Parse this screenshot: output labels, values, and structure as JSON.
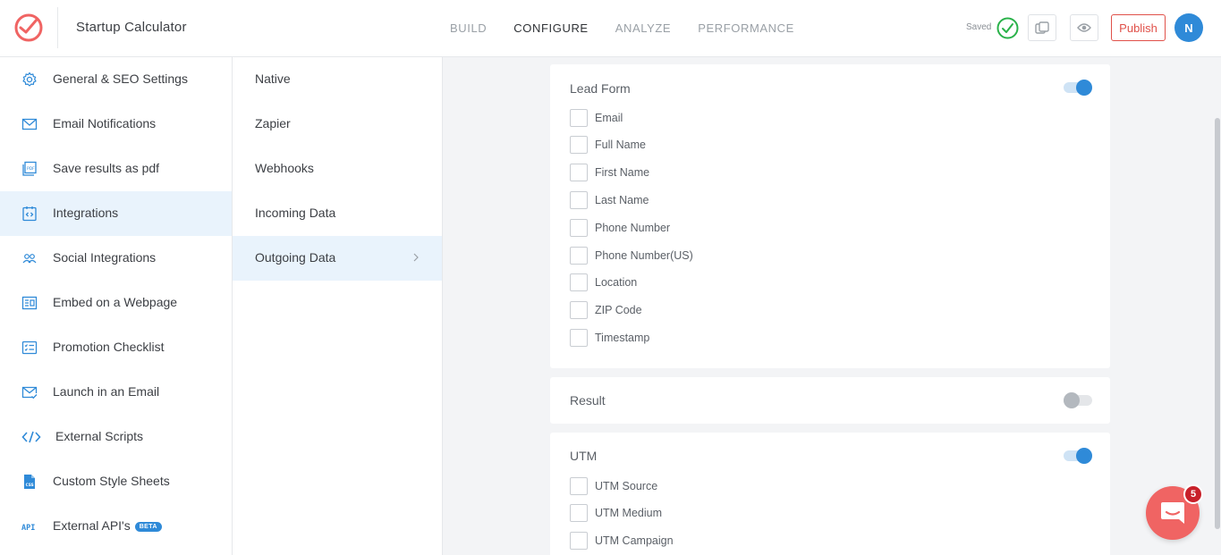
{
  "header": {
    "app_title": "Startup Calculator",
    "tabs": [
      {
        "label": "BUILD",
        "active": false
      },
      {
        "label": "CONFIGURE",
        "active": true
      },
      {
        "label": "ANALYZE",
        "active": false
      },
      {
        "label": "PERFORMANCE",
        "active": false
      }
    ],
    "saved_label": "Saved",
    "publish_label": "Publish",
    "avatar_initial": "N"
  },
  "sidebar": {
    "items": [
      {
        "label": "General & SEO Settings",
        "icon": "gear-icon",
        "active": false
      },
      {
        "label": "Email Notifications",
        "icon": "envelope-icon",
        "active": false
      },
      {
        "label": "Save results as pdf",
        "icon": "pdf-icon",
        "active": false
      },
      {
        "label": "Integrations",
        "icon": "integrations-icon",
        "active": true
      },
      {
        "label": "Social Integrations",
        "icon": "people-icon",
        "active": false
      },
      {
        "label": "Embed on a Webpage",
        "icon": "embed-icon",
        "active": false
      },
      {
        "label": "Promotion Checklist",
        "icon": "checklist-icon",
        "active": false
      },
      {
        "label": "Launch in an Email",
        "icon": "envelope-check-icon",
        "active": false
      },
      {
        "label": "External Scripts",
        "icon": "code-icon",
        "active": false
      },
      {
        "label": "Custom Style Sheets",
        "icon": "css-file-icon",
        "active": false
      },
      {
        "label": "External API's",
        "icon": "api-icon",
        "active": false,
        "badge": "BETA"
      }
    ]
  },
  "submenu": {
    "items": [
      {
        "label": "Native",
        "active": false
      },
      {
        "label": "Zapier",
        "active": false
      },
      {
        "label": "Webhooks",
        "active": false
      },
      {
        "label": "Incoming Data",
        "active": false
      },
      {
        "label": "Outgoing Data",
        "active": true
      }
    ]
  },
  "main": {
    "lead_form": {
      "title": "Lead Form",
      "enabled": true,
      "fields": [
        "Email",
        "Full Name",
        "First Name",
        "Last Name",
        "Phone Number",
        "Phone Number(US)",
        "Location",
        "ZIP Code",
        "Timestamp"
      ]
    },
    "result": {
      "title": "Result",
      "enabled": false
    },
    "utm": {
      "title": "UTM",
      "enabled": true,
      "fields": [
        "UTM Source",
        "UTM Medium",
        "UTM Campaign"
      ]
    }
  },
  "chat": {
    "badge_count": "5"
  },
  "colors": {
    "accent": "#2f8ad8",
    "publish": "#e0514a",
    "saved_check": "#2ab24a",
    "chat": "#f06463"
  }
}
